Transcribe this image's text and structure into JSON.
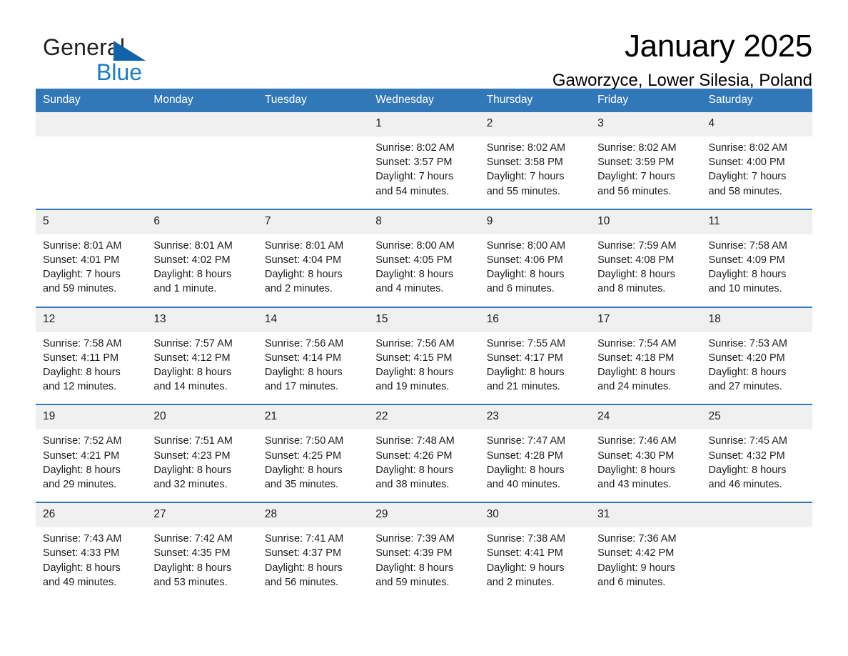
{
  "logo": {
    "word1": "General",
    "word2": "Blue",
    "triangle_color": "#1063a8",
    "word2_color": "#1a7bc4"
  },
  "header": {
    "title": "January 2025",
    "location": "Gaworzyce, Lower Silesia, Poland"
  },
  "theme": {
    "header_blue": "#3278b8",
    "daynum_gray": "#f0f0f0",
    "text": "#1c1c1c"
  },
  "calendar": {
    "weekday_headers": [
      "Sunday",
      "Monday",
      "Tuesday",
      "Wednesday",
      "Thursday",
      "Friday",
      "Saturday"
    ],
    "weeks": [
      [
        {
          "day": "",
          "lines": []
        },
        {
          "day": "",
          "lines": []
        },
        {
          "day": "",
          "lines": []
        },
        {
          "day": "1",
          "lines": [
            "Sunrise: 8:02 AM",
            "Sunset: 3:57 PM",
            "Daylight: 7 hours",
            "and 54 minutes."
          ]
        },
        {
          "day": "2",
          "lines": [
            "Sunrise: 8:02 AM",
            "Sunset: 3:58 PM",
            "Daylight: 7 hours",
            "and 55 minutes."
          ]
        },
        {
          "day": "3",
          "lines": [
            "Sunrise: 8:02 AM",
            "Sunset: 3:59 PM",
            "Daylight: 7 hours",
            "and 56 minutes."
          ]
        },
        {
          "day": "4",
          "lines": [
            "Sunrise: 8:02 AM",
            "Sunset: 4:00 PM",
            "Daylight: 7 hours",
            "and 58 minutes."
          ]
        }
      ],
      [
        {
          "day": "5",
          "lines": [
            "Sunrise: 8:01 AM",
            "Sunset: 4:01 PM",
            "Daylight: 7 hours",
            "and 59 minutes."
          ]
        },
        {
          "day": "6",
          "lines": [
            "Sunrise: 8:01 AM",
            "Sunset: 4:02 PM",
            "Daylight: 8 hours",
            "and 1 minute."
          ]
        },
        {
          "day": "7",
          "lines": [
            "Sunrise: 8:01 AM",
            "Sunset: 4:04 PM",
            "Daylight: 8 hours",
            "and 2 minutes."
          ]
        },
        {
          "day": "8",
          "lines": [
            "Sunrise: 8:00 AM",
            "Sunset: 4:05 PM",
            "Daylight: 8 hours",
            "and 4 minutes."
          ]
        },
        {
          "day": "9",
          "lines": [
            "Sunrise: 8:00 AM",
            "Sunset: 4:06 PM",
            "Daylight: 8 hours",
            "and 6 minutes."
          ]
        },
        {
          "day": "10",
          "lines": [
            "Sunrise: 7:59 AM",
            "Sunset: 4:08 PM",
            "Daylight: 8 hours",
            "and 8 minutes."
          ]
        },
        {
          "day": "11",
          "lines": [
            "Sunrise: 7:58 AM",
            "Sunset: 4:09 PM",
            "Daylight: 8 hours",
            "and 10 minutes."
          ]
        }
      ],
      [
        {
          "day": "12",
          "lines": [
            "Sunrise: 7:58 AM",
            "Sunset: 4:11 PM",
            "Daylight: 8 hours",
            "and 12 minutes."
          ]
        },
        {
          "day": "13",
          "lines": [
            "Sunrise: 7:57 AM",
            "Sunset: 4:12 PM",
            "Daylight: 8 hours",
            "and 14 minutes."
          ]
        },
        {
          "day": "14",
          "lines": [
            "Sunrise: 7:56 AM",
            "Sunset: 4:14 PM",
            "Daylight: 8 hours",
            "and 17 minutes."
          ]
        },
        {
          "day": "15",
          "lines": [
            "Sunrise: 7:56 AM",
            "Sunset: 4:15 PM",
            "Daylight: 8 hours",
            "and 19 minutes."
          ]
        },
        {
          "day": "16",
          "lines": [
            "Sunrise: 7:55 AM",
            "Sunset: 4:17 PM",
            "Daylight: 8 hours",
            "and 21 minutes."
          ]
        },
        {
          "day": "17",
          "lines": [
            "Sunrise: 7:54 AM",
            "Sunset: 4:18 PM",
            "Daylight: 8 hours",
            "and 24 minutes."
          ]
        },
        {
          "day": "18",
          "lines": [
            "Sunrise: 7:53 AM",
            "Sunset: 4:20 PM",
            "Daylight: 8 hours",
            "and 27 minutes."
          ]
        }
      ],
      [
        {
          "day": "19",
          "lines": [
            "Sunrise: 7:52 AM",
            "Sunset: 4:21 PM",
            "Daylight: 8 hours",
            "and 29 minutes."
          ]
        },
        {
          "day": "20",
          "lines": [
            "Sunrise: 7:51 AM",
            "Sunset: 4:23 PM",
            "Daylight: 8 hours",
            "and 32 minutes."
          ]
        },
        {
          "day": "21",
          "lines": [
            "Sunrise: 7:50 AM",
            "Sunset: 4:25 PM",
            "Daylight: 8 hours",
            "and 35 minutes."
          ]
        },
        {
          "day": "22",
          "lines": [
            "Sunrise: 7:48 AM",
            "Sunset: 4:26 PM",
            "Daylight: 8 hours",
            "and 38 minutes."
          ]
        },
        {
          "day": "23",
          "lines": [
            "Sunrise: 7:47 AM",
            "Sunset: 4:28 PM",
            "Daylight: 8 hours",
            "and 40 minutes."
          ]
        },
        {
          "day": "24",
          "lines": [
            "Sunrise: 7:46 AM",
            "Sunset: 4:30 PM",
            "Daylight: 8 hours",
            "and 43 minutes."
          ]
        },
        {
          "day": "25",
          "lines": [
            "Sunrise: 7:45 AM",
            "Sunset: 4:32 PM",
            "Daylight: 8 hours",
            "and 46 minutes."
          ]
        }
      ],
      [
        {
          "day": "26",
          "lines": [
            "Sunrise: 7:43 AM",
            "Sunset: 4:33 PM",
            "Daylight: 8 hours",
            "and 49 minutes."
          ]
        },
        {
          "day": "27",
          "lines": [
            "Sunrise: 7:42 AM",
            "Sunset: 4:35 PM",
            "Daylight: 8 hours",
            "and 53 minutes."
          ]
        },
        {
          "day": "28",
          "lines": [
            "Sunrise: 7:41 AM",
            "Sunset: 4:37 PM",
            "Daylight: 8 hours",
            "and 56 minutes."
          ]
        },
        {
          "day": "29",
          "lines": [
            "Sunrise: 7:39 AM",
            "Sunset: 4:39 PM",
            "Daylight: 8 hours",
            "and 59 minutes."
          ]
        },
        {
          "day": "30",
          "lines": [
            "Sunrise: 7:38 AM",
            "Sunset: 4:41 PM",
            "Daylight: 9 hours",
            "and 2 minutes."
          ]
        },
        {
          "day": "31",
          "lines": [
            "Sunrise: 7:36 AM",
            "Sunset: 4:42 PM",
            "Daylight: 9 hours",
            "and 6 minutes."
          ]
        },
        {
          "day": "",
          "lines": []
        }
      ]
    ]
  }
}
